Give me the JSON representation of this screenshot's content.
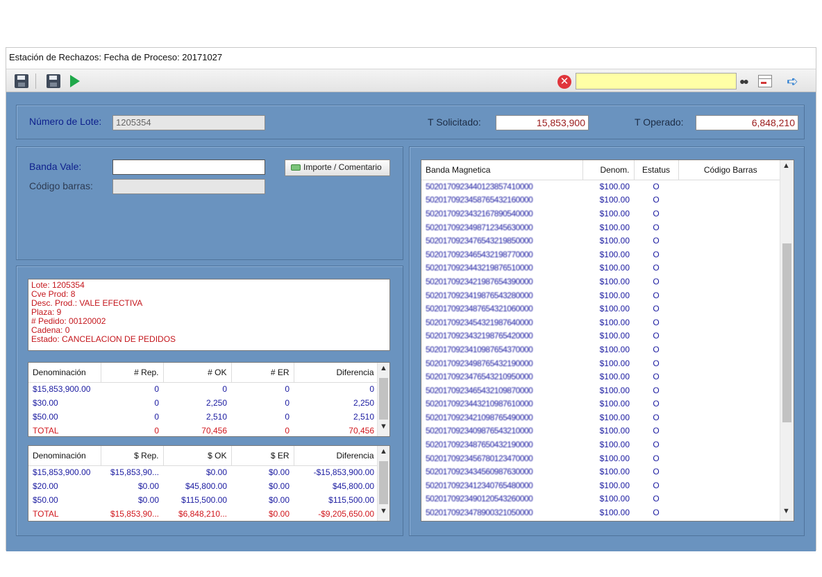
{
  "window": {
    "title": "Estación de Rechazos: Fecha de Proceso: 20171027"
  },
  "toolbar": {
    "save1_icon": "floppy-disk-icon",
    "save2_icon": "floppy-disk-icon",
    "run_icon": "play-icon",
    "error_glyph": "✕",
    "search_value": "",
    "binoculars_glyph": "👓",
    "arrow_glyph": "➪"
  },
  "lote": {
    "label": "Número de Lote:",
    "value": "1205354"
  },
  "totals": {
    "solicitado_label": "T Solicitado:",
    "solicitado_value": "15,853,900",
    "operado_label": "T Operado:",
    "operado_value": "6,848,210"
  },
  "banda": {
    "label": "Banda Vale:",
    "value": "",
    "codigo_label": "Código barras:",
    "codigo_value": "",
    "button_label": "Importe / Comentario"
  },
  "info_lines": [
    "Lote: 1205354",
    "Cve Prod: 8",
    "Desc. Prod.: VALE EFECTIVA",
    "Plaza: 9",
    "# Pedido: 00120002",
    "Cadena: 0",
    "Estado: CANCELACION DE PEDIDOS"
  ],
  "grid_counts": {
    "headers": [
      "Denominación",
      "# Rep.",
      "# OK",
      "# ER",
      "Diferencia"
    ],
    "rows": [
      [
        "$15,853,900.00",
        "0",
        "0",
        "0",
        "0"
      ],
      [
        "$30.00",
        "0",
        "2,250",
        "0",
        "2,250"
      ],
      [
        "$50.00",
        "0",
        "2,510",
        "0",
        "2,510"
      ]
    ],
    "total": [
      "TOTAL",
      "0",
      "70,456",
      "0",
      "70,456"
    ]
  },
  "grid_amounts": {
    "headers": [
      "Denominación",
      "$ Rep.",
      "$ OK",
      "$ ER",
      "Diferencia"
    ],
    "rows": [
      [
        "$15,853,900.00",
        "$15,853,90...",
        "$0.00",
        "$0.00",
        "-$15,853,900.00"
      ],
      [
        "$20.00",
        "$0.00",
        "$45,800.00",
        "$0.00",
        "$45,800.00"
      ],
      [
        "$50.00",
        "$0.00",
        "$115,500.00",
        "$0.00",
        "$115,500.00"
      ]
    ],
    "total": [
      "TOTAL",
      "$15,853,90...",
      "$6,848,210...",
      "$0.00",
      "-$9,205,650.00"
    ]
  },
  "grid_bands": {
    "headers": [
      "Banda Magnetica",
      "Denom.",
      "Estatus",
      "Código Barras"
    ],
    "rows": [
      [
        "5020170923440123857410000",
        "$100.00",
        "O",
        ""
      ],
      [
        "5020170923458765432160000",
        "$100.00",
        "O",
        ""
      ],
      [
        "5020170923432167890540000",
        "$100.00",
        "O",
        ""
      ],
      [
        "5020170923498712345630000",
        "$100.00",
        "O",
        ""
      ],
      [
        "5020170923476543219850000",
        "$100.00",
        "O",
        ""
      ],
      [
        "5020170923465432198770000",
        "$100.00",
        "O",
        ""
      ],
      [
        "5020170923443219876510000",
        "$100.00",
        "O",
        ""
      ],
      [
        "5020170923421987654390000",
        "$100.00",
        "O",
        ""
      ],
      [
        "5020170923419876543280000",
        "$100.00",
        "O",
        ""
      ],
      [
        "5020170923487654321060000",
        "$100.00",
        "O",
        ""
      ],
      [
        "5020170923454321987640000",
        "$100.00",
        "O",
        ""
      ],
      [
        "5020170923432198765420000",
        "$100.00",
        "O",
        ""
      ],
      [
        "5020170923410987654370000",
        "$100.00",
        "O",
        ""
      ],
      [
        "5020170923498765432190000",
        "$100.00",
        "O",
        ""
      ],
      [
        "5020170923476543210950000",
        "$100.00",
        "O",
        ""
      ],
      [
        "5020170923465432109870000",
        "$100.00",
        "O",
        ""
      ],
      [
        "5020170923443210987610000",
        "$100.00",
        "O",
        ""
      ],
      [
        "5020170923421098765490000",
        "$100.00",
        "O",
        ""
      ],
      [
        "5020170923409876543210000",
        "$100.00",
        "O",
        ""
      ],
      [
        "5020170923487650432190000",
        "$100.00",
        "O",
        ""
      ],
      [
        "5020170923456780123470000",
        "$100.00",
        "O",
        ""
      ],
      [
        "5020170923434560987630000",
        "$100.00",
        "O",
        ""
      ],
      [
        "5020170923412340765480000",
        "$100.00",
        "O",
        ""
      ],
      [
        "5020170923490120543260000",
        "$100.00",
        "O",
        ""
      ],
      [
        "5020170923478900321050000",
        "$100.00",
        "O",
        ""
      ]
    ]
  }
}
